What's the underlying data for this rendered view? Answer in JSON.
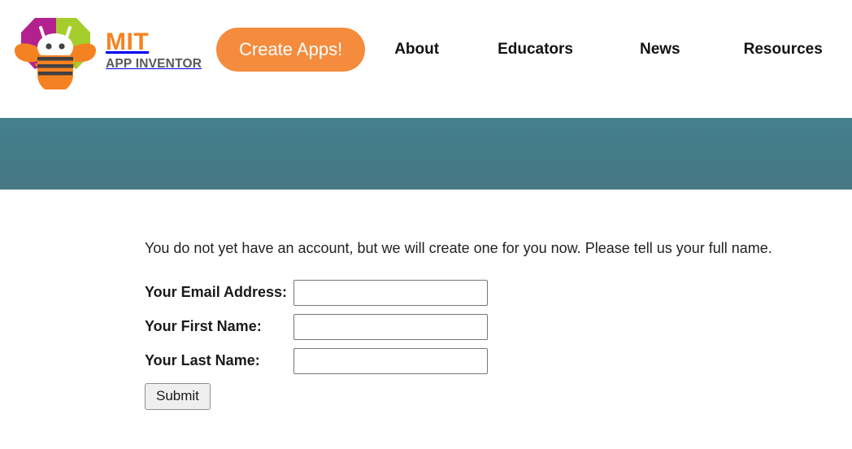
{
  "header": {
    "brand": {
      "logo_icon": "app-inventor-bee-logo",
      "wordmark_primary": "MIT",
      "wordmark_secondary": "APP INVENTOR",
      "colors": {
        "orange": "#f58220",
        "gray": "#58595b",
        "hex_magenta": "#b3218e",
        "hex_green": "#a5ce2c",
        "bee_orange": "#f58220",
        "bee_dark": "#414042"
      }
    },
    "cta": {
      "label": "Create Apps!",
      "background": "#f58b3c",
      "text_color": "#ffffff"
    },
    "nav_items": [
      {
        "label": "About"
      },
      {
        "label": "Educators"
      },
      {
        "label": "News"
      },
      {
        "label": "Resources"
      }
    ]
  },
  "banner": {
    "background_color": "#447b87"
  },
  "main": {
    "intro": "You do not yet have an account, but we will create one for you now. Please tell us your full name.",
    "form": {
      "fields": [
        {
          "label": "Your Email Address:",
          "value": "",
          "placeholder": ""
        },
        {
          "label": "Your First Name:",
          "value": "",
          "placeholder": ""
        },
        {
          "label": "Your Last Name:",
          "value": "",
          "placeholder": ""
        }
      ],
      "submit_label": "Submit"
    }
  }
}
